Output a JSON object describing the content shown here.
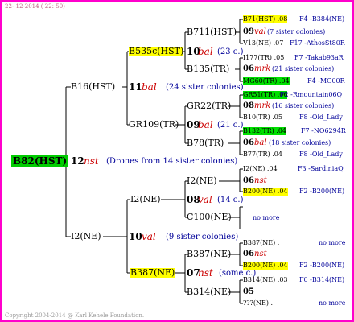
{
  "header": {
    "date": "22- 12-2014 ( 22: 50)"
  },
  "footer": {
    "copyright": "Copyright 2004-2014 @ Karl Kehele Foundation."
  },
  "root": {
    "name": "B82(HST)",
    "gen": "12",
    "mark": "nst",
    "note": "(Drones from 14 sister colonies)"
  },
  "b16": {
    "name": "B16(HST)",
    "gen": "11",
    "mark": "bal",
    "note": "(24 sister colonies)"
  },
  "b535": {
    "name": "B535c(HST)",
    "gen": "10",
    "mark": "bal",
    "note": "(23 c.)"
  },
  "b711": {
    "name": "B711(HST)",
    "gen": "09",
    "mark": "val",
    "note": "(7 sister colonies)"
  },
  "b135": {
    "name": "B135(TR)",
    "gen": "06",
    "mark": "mrk",
    "note": "(21 sister colonies)"
  },
  "gr109": {
    "name": "GR109(TR)",
    "gen": "09",
    "mark": "bal",
    "note": "(21 c.)"
  },
  "gr22": {
    "name": "GR22(TR)",
    "gen": "08",
    "mark": "mrk",
    "note": "(16 sister colonies)"
  },
  "b78": {
    "name": "B78(TR)",
    "gen": "06",
    "mark": "bal",
    "note": "(18 sister colonies)"
  },
  "i2": {
    "name": "I2(NE)",
    "gen": "10",
    "mark": "val",
    "note": "(9 sister colonies)"
  },
  "i2b": {
    "name": "I2(NE)",
    "gen": "08",
    "mark": "val",
    "note": "(14 c.)"
  },
  "i2c": {
    "name": "I2(NE)",
    "gen": "06",
    "mark": "nst"
  },
  "c100": {
    "name": "C100(NE)",
    "more": "no more"
  },
  "b387": {
    "name": "B387(NE)",
    "gen": "07",
    "mark": "nst",
    "note": "(some c.)"
  },
  "b387b": {
    "name": "B387(NE)",
    "gen": "06",
    "mark": "nst"
  },
  "b314": {
    "name": "B314(NE)",
    "gen": "05"
  },
  "right": [
    {
      "name": "B71(HST) .08",
      "code": "F4 -B384(NE)"
    },
    {
      "name": "V13(NE) .07",
      "code": "F17 -AthosSt80R"
    },
    {
      "name": "I177(TR) .05",
      "code": "F7 -Takab93aR"
    },
    {
      "name": "MG60(TR) .04",
      "code": "F4 -MG00R"
    },
    {
      "name": "GR51(TR) .06",
      "code": "F2 -Rmountain06Q"
    },
    {
      "name": "B10(TR) .05",
      "code": "F8 -Old_Lady"
    },
    {
      "name": "B132(TR) .04",
      "code": "F7 -NO6294R"
    },
    {
      "name": "B77(TR) .04",
      "code": "F8 -Old_Lady"
    },
    {
      "name": "I2(NE) .04",
      "code": "F3 -SardiniaQ"
    },
    {
      "name": "B200(NE) .04",
      "code": "F2 -B200(NE)"
    },
    {
      "name": "B387(NE) .",
      "code": "no more"
    },
    {
      "name": "B200(NE) .04",
      "code": "F2 -B200(NE)"
    },
    {
      "name": "B314(NE) .03",
      "code": "F0 -B314(NE)"
    },
    {
      "name": "???(NE) .",
      "code": "no more"
    }
  ],
  "colors": {
    "frame": "#ff00cc",
    "root_bg": "#00cc00",
    "yellow": "#ffff00",
    "green": "#00e000",
    "blue": "#000099",
    "red": "#cc0000"
  }
}
